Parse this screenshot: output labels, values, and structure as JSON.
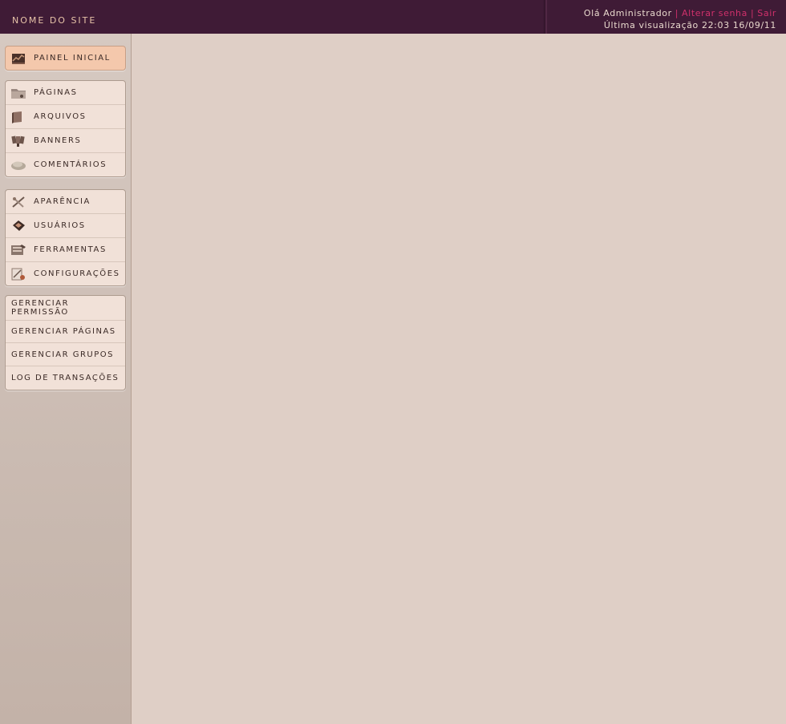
{
  "header": {
    "site_name": "NOME DO SITE",
    "greeting": "Olá Administrador",
    "change_password": "Alterar senha",
    "logout": "Sair",
    "last_visit": "Última visualização 22:03 16/09/11"
  },
  "sidebar": {
    "home": {
      "label": "PAINEL INICIAL",
      "icon": "dashboard-icon"
    },
    "content": [
      {
        "label": "PÁGINAS",
        "icon": "folder-icon"
      },
      {
        "label": "ARQUIVOS",
        "icon": "book-icon"
      },
      {
        "label": "BANNERS",
        "icon": "banners-icon"
      },
      {
        "label": "COMENTÁRIOS",
        "icon": "comments-icon"
      }
    ],
    "system": [
      {
        "label": "APARÊNCIA",
        "icon": "appearance-icon"
      },
      {
        "label": "USUÁRIOS",
        "icon": "users-icon"
      },
      {
        "label": "FERRAMENTAS",
        "icon": "tools-icon"
      },
      {
        "label": "CONFIGURAÇÕES",
        "icon": "settings-icon"
      }
    ],
    "admin": [
      {
        "label": "GERENCIAR PERMISSÃO"
      },
      {
        "label": "GERENCIAR PÁGINAS"
      },
      {
        "label": "GERENCIAR GRUPOS"
      },
      {
        "label": "LOG DE TRANSAÇÕES"
      }
    ]
  },
  "colors": {
    "header_bg": "#3f1b36",
    "accent_link": "#d0306b",
    "content_bg": "#dfcfc6",
    "active_item": "#f4c8ac"
  }
}
